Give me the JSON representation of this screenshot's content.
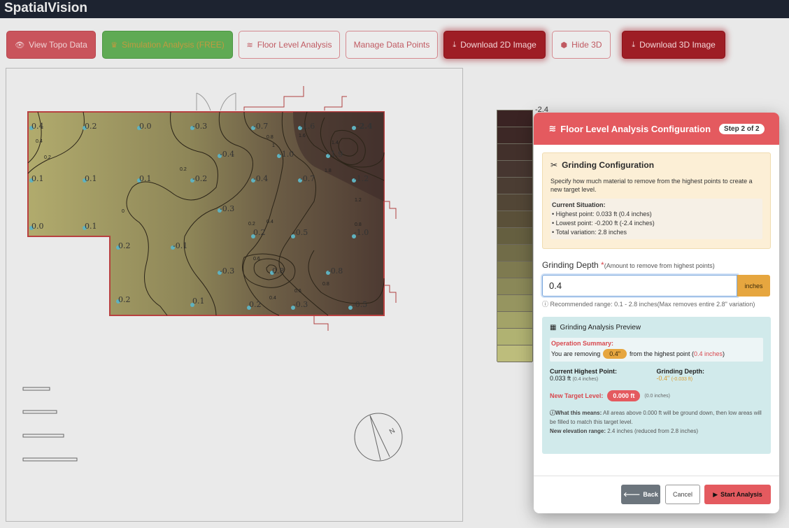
{
  "app": {
    "title": "SpatialVision"
  },
  "toolbar": {
    "view_topo": {
      "label": "View Topo Data",
      "icon": "eye-icon"
    },
    "simulation": {
      "label": "Simulation Analysis (FREE)",
      "icon": "crown-icon"
    },
    "floor_level": {
      "label": "Floor Level Analysis",
      "icon": "layers-icon"
    },
    "manage_points": {
      "label": "Manage Data Points"
    },
    "download_2d": {
      "label": "Download 2D Image",
      "icon": "download-icon"
    },
    "hide_3d": {
      "label": "Hide 3D",
      "icon": "cube-icon"
    },
    "download_3d": {
      "label": "Download 3D Image",
      "icon": "download-icon"
    }
  },
  "map": {
    "colorbar_top_label": "-2.4",
    "point_labels": [
      "0.4",
      "0.2",
      "0.0",
      "-0.3",
      "-0.7",
      "-1.6",
      "-2.4",
      "-0.4",
      "-1.0",
      "-1.9",
      "0.1",
      "0.1",
      "0.1",
      "-0.2",
      "-0.4",
      "-0.7",
      "-1.2",
      "-0.3",
      "0.0",
      "0.1",
      "0.2",
      "-0.1",
      "0.2",
      "-0.5",
      "-1.0",
      "-0.3",
      "0.8",
      "-0.8",
      "0.2",
      "0.1",
      "0.2",
      "-0.3",
      "-0.5"
    ],
    "contour_labels": [
      "0.4",
      "0.2",
      "0.2",
      "0",
      "0.2",
      "0.4",
      "0.6",
      "0.8",
      "1",
      "1.2",
      "1.4",
      "1.6",
      "1.8",
      "0.4",
      "0.6",
      "0.8",
      "0.8"
    ],
    "compass_label": "N"
  },
  "modal": {
    "title": "Floor Level Analysis Configuration",
    "step": "Step 2 of 2",
    "grinding": {
      "title": "Grinding Configuration",
      "description": "Specify how much material to remove from the highest points to create a new target level.",
      "situation_title": "Current Situation:",
      "highest_prefix": "• Highest point: ",
      "highest_value": "0.033 ft",
      "highest_suffix": " (0.4 inches)",
      "lowest_prefix": "• Lowest point: ",
      "lowest_value": "-0.200 ft",
      "lowest_suffix": " (-2.4 inches)",
      "variation_prefix": "• Total variation: ",
      "variation_value": "2.8 inches"
    },
    "depth": {
      "label": "Grinding Depth ",
      "required": "*",
      "sublabel": "(Amount to remove from highest points)",
      "value": "0.4",
      "unit": "inches",
      "hint": "Recommended range: 0.1 - 2.8 inches(Max removes entire 2.8\" variation)"
    },
    "preview": {
      "title": "Grinding Analysis Preview",
      "summary_title": "Operation Summary:",
      "removing_prefix": "You are removing",
      "removing_value": "0.4\"",
      "removing_middle": "from the highest point (",
      "removing_red": "0.4 inches",
      "removing_end": ")",
      "current_highest_label": "Current Highest Point:",
      "current_highest_value": "0.033 ft",
      "current_highest_small": "(0.4 inches)",
      "grinding_depth_label": "Grinding Depth:",
      "grinding_depth_value": "-0.4\"",
      "grinding_depth_small": "(-0.033 ft)",
      "new_target_label": "New Target Level:",
      "new_target_value": "0.000 ft",
      "new_target_small": "(0.0 inches)",
      "means_title": "What this means:",
      "means_text": " All areas above 0.000 ft will be ground down, then low areas will be filled to match this target level.",
      "range_title": "New elevation range:",
      "range_text": " 2.4 inches (reduced from 2.8 inches)"
    },
    "buttons": {
      "back": "Back",
      "cancel": "Cancel",
      "start": "Start Analysis"
    }
  },
  "colors": {
    "accent_red": "#e45a5f",
    "accent_orange": "#e6a63f",
    "colorbar": [
      "#3a2323",
      "#3d2826",
      "#42302b",
      "#463630",
      "#4b3d33",
      "#524636",
      "#5a5039",
      "#655f40",
      "#716c48",
      "#7e7a50",
      "#8a8858",
      "#969560",
      "#a3a368",
      "#b0b272",
      "#bdbd7c"
    ]
  }
}
